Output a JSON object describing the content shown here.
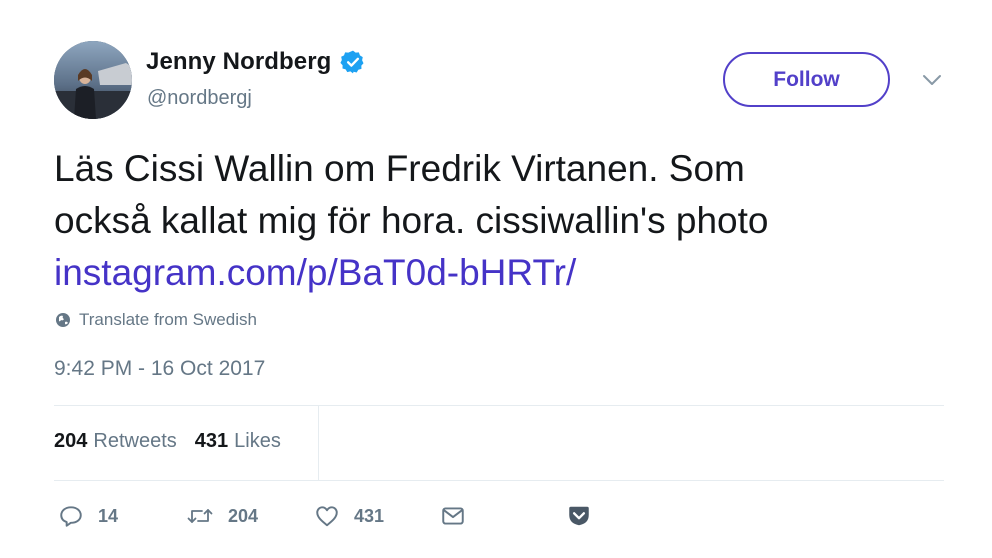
{
  "user": {
    "display_name": "Jenny Nordberg",
    "handle": "@nordbergj",
    "verified_icon": "verified-badge-icon"
  },
  "follow": {
    "label": "Follow",
    "color": "#5240c9"
  },
  "tweet": {
    "text_line1": "Läs Cissi Wallin om Fredrik Virtanen. Som",
    "text_line2": "också kallat mig för hora. cissiwallin's photo",
    "link": "instagram.com/p/BaT0d-bHRTr/",
    "translate": "Translate from Swedish",
    "timestamp": "9:42 PM - 16 Oct 2017"
  },
  "stats": {
    "retweets_count": "204",
    "retweets_label": "Retweets",
    "likes_count": "431",
    "likes_label": "Likes"
  },
  "actions": {
    "reply_count": "14",
    "retweet_count": "204",
    "like_count": "431"
  },
  "colors": {
    "link": "#4533c7",
    "muted": "#657786",
    "text": "#14171a",
    "verified": "#1da1f2"
  }
}
